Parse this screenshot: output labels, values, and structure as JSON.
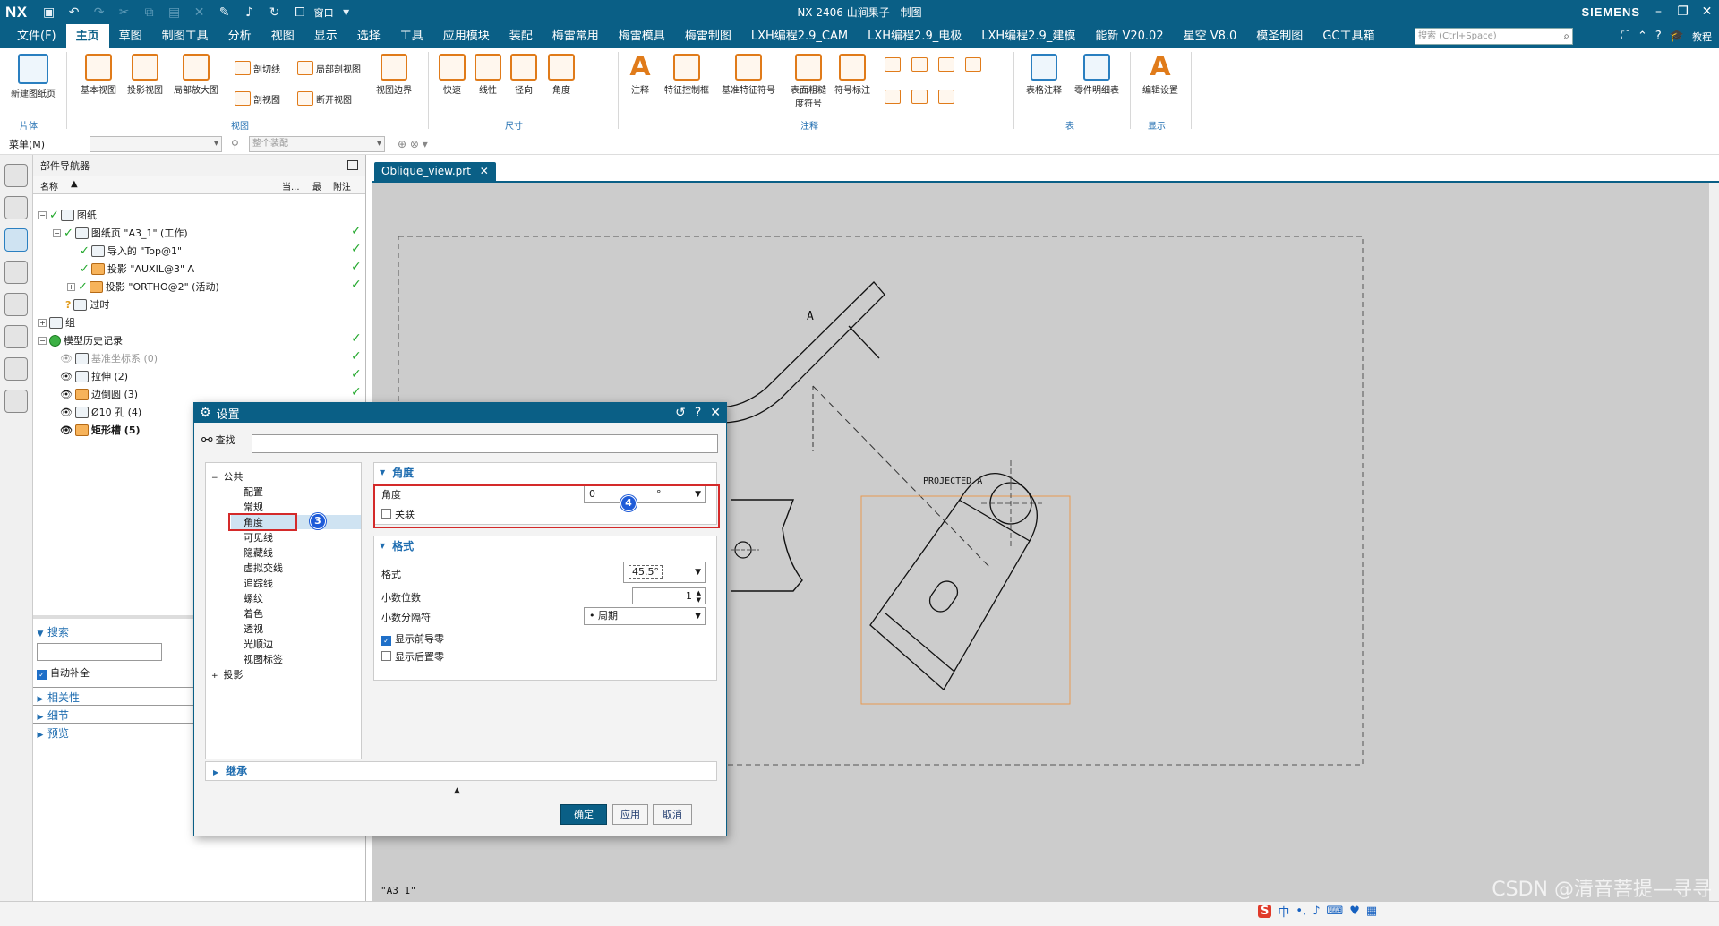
{
  "titlebar": {
    "logo": "NX",
    "window_menu": "窗口",
    "title": "NX 2406 山涧果子 - 制图",
    "brand": "SIEMENS"
  },
  "menubar": {
    "tabs": [
      "文件(F)",
      "主页",
      "草图",
      "制图工具",
      "分析",
      "视图",
      "显示",
      "选择",
      "工具",
      "应用模块",
      "装配",
      "梅雷常用",
      "梅雷模具",
      "梅雷制图",
      "LXH编程2.9_CAM",
      "LXH编程2.9_电极",
      "LXH编程2.9_建模",
      "能新 V20.02",
      "星空 V8.0",
      "模圣制图",
      "GC工具箱"
    ],
    "active_tab": "主页",
    "search_placeholder": "搜索 (Ctrl+Space)",
    "tutorial": "教程"
  },
  "ribbon": {
    "new_sheet": "新建图纸页",
    "base_view": "基本视图",
    "projected_view": "投影视图",
    "detail_view": "局部放大图",
    "section_line": "剖切线",
    "section_view": "剖视图",
    "break_section": "局部剖视图",
    "break_view": "断开视图",
    "view_boundary": "视图边界",
    "rapid": "快速",
    "linear": "线性",
    "radial": "径向",
    "angular": "角度",
    "note": "注释",
    "fcf": "特征控制框",
    "datum_symbol": "基准特征符号",
    "surface_finish": "表面粗糙度符号",
    "symbol_label": "符号标注",
    "tabular_note": "表格注释",
    "parts_list": "零件明细表",
    "edit_settings": "编辑设置",
    "groups": {
      "sheet": "片体",
      "view": "视图",
      "dimension": "尺寸",
      "annotation": "注释",
      "table": "表",
      "display": "显示"
    }
  },
  "selbar": {
    "menu": "菜单(M)",
    "filter_placeholder": "整个装配"
  },
  "navigator": {
    "title": "部件导航器",
    "columns": {
      "name": "名称",
      "current": "当...",
      "latest": "最",
      "attached": "附注"
    },
    "rows": [
      {
        "label": "图纸"
      },
      {
        "label": "图纸页 \"A3_1\" (工作)"
      },
      {
        "label": "导入的 \"Top@1\""
      },
      {
        "label": "投影 \"AUXIL@3\" A"
      },
      {
        "label": "投影 \"ORTHO@2\" (活动)"
      },
      {
        "label": "过时"
      },
      {
        "label": "组"
      },
      {
        "label": "模型历史记录"
      },
      {
        "label": "基准坐标系 (0)"
      },
      {
        "label": "拉伸 (2)"
      },
      {
        "label": "边倒圆 (3)"
      },
      {
        "label": "Ø10 孔 (4)"
      },
      {
        "label": "矩形槽 (5)"
      }
    ],
    "search_label": "搜索",
    "autocomplete": "自动补全",
    "sections": [
      "相关性",
      "细节",
      "预览"
    ]
  },
  "document": {
    "tab": "Oblique_view.prt",
    "sheet_label": "\"A3_1\"",
    "view_label_a": "A",
    "projected_label": "PROJECTED A"
  },
  "dialog": {
    "title": "设置",
    "find_label": "查找",
    "tree": {
      "common": "公共",
      "items": [
        "配置",
        "常规",
        "角度",
        "可见线",
        "隐藏线",
        "虚拟交线",
        "追踪线",
        "螺纹",
        "着色",
        "透视",
        "光顺边",
        "视图标签"
      ],
      "selected": "角度",
      "projection": "投影"
    },
    "angle_section": {
      "title": "角度",
      "angle_label": "角度",
      "angle_value": "0",
      "angle_unit": "°",
      "associative_label": "关联",
      "associative": false
    },
    "format_section": {
      "title": "格式",
      "format_label": "格式",
      "format_value": "45.5°",
      "decimals_label": "小数位数",
      "decimals_value": "1",
      "separator_label": "小数分隔符",
      "separator_value": "• 周期",
      "leading_zeros_label": "显示前导零",
      "leading_zeros": true,
      "trailing_zeros_label": "显示后置零",
      "trailing_zeros": false
    },
    "inherit_label": "继承",
    "ok": "确定",
    "apply": "应用",
    "cancel": "取消",
    "badges": {
      "tree": "3",
      "angle": "4"
    }
  },
  "status": {
    "watermark": "CSDN @清音菩提—寻寻",
    "ime": "中"
  },
  "colors": {
    "accent": "#0a5f86",
    "highlight_red": "#d42a2a",
    "badge_blue": "#1e5bd8",
    "view_border": "#e89a52",
    "canvas": "#cccccc"
  }
}
